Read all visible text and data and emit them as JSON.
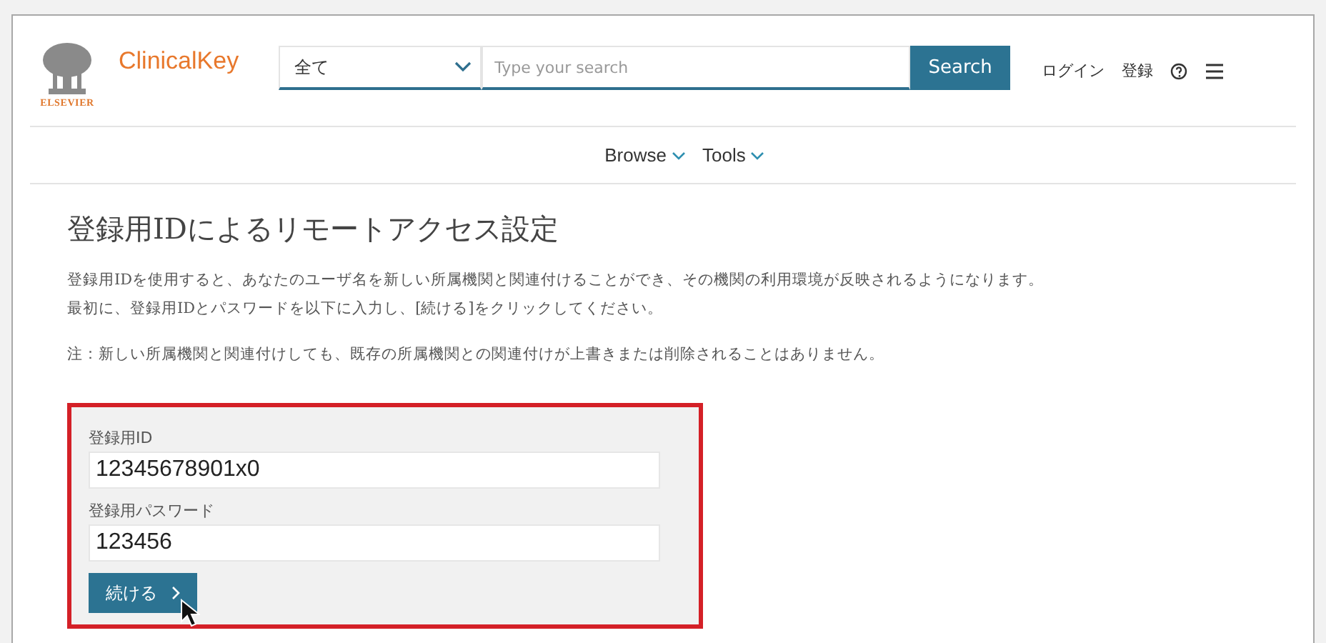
{
  "header": {
    "publisher": "ELSEVIER",
    "brand": "ClinicalKey",
    "scope_select": {
      "value": "全て"
    },
    "search": {
      "placeholder": "Type your search"
    },
    "search_button": "Search",
    "links": [
      "ログイン",
      "登録"
    ]
  },
  "nav": [
    "Browse",
    "Tools"
  ],
  "heading": "登録用IDによるリモートアクセス設定",
  "intro": [
    "登録用IDを使用すると、あなたのユーザ名を新しい所属機関と関連付けることができ、その機関の利用環境が反映されるようになります。",
    "最初に、登録用IDとパスワードを以下に入力し、[続ける]をクリックしてください。"
  ],
  "note": "注：新しい所属機関と関連付けしても、既存の所属機関との関連付けが上書きまたは削除されることはありません。",
  "form": {
    "fields": [
      {
        "label": "登録用ID",
        "value": "12345678901x0"
      },
      {
        "label": "登録用パスワード",
        "value": "123456"
      }
    ],
    "submit": "続ける"
  }
}
